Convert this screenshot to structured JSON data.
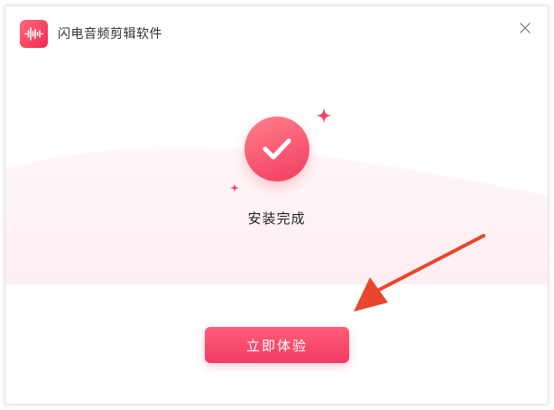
{
  "window": {
    "title": "闪电音频剪辑软件",
    "logo_icon": "audio-wave-icon",
    "close_icon": "close-icon"
  },
  "install": {
    "status_icon": "checkmark-icon",
    "status_text": "安装完成",
    "launch_button_label": "立即体验"
  },
  "colors": {
    "accent": "#f23c62",
    "accent_light": "#ff7f8c",
    "annotation_arrow": "#e8472c"
  }
}
